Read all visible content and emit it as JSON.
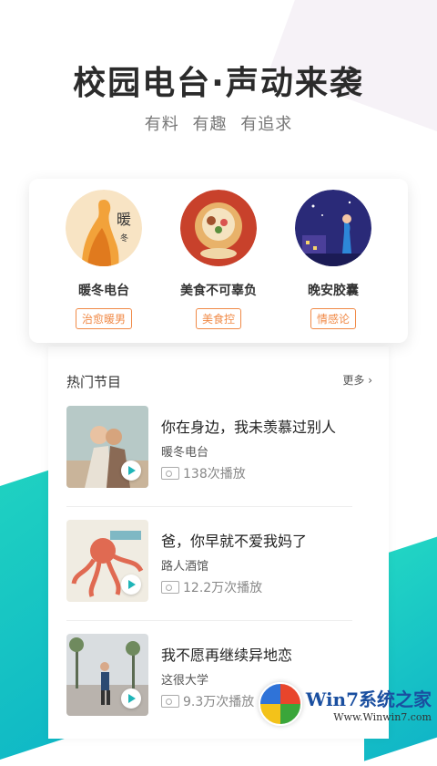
{
  "header": {
    "title": "校园电台·声动来袭",
    "tagline_items": [
      "有料",
      "有趣",
      "有追求"
    ]
  },
  "categories": [
    {
      "name": "暖冬电台",
      "tag": "治愈暖男",
      "thumb_icon": "warm-winter-cover"
    },
    {
      "name": "美食不可辜负",
      "tag": "美食控",
      "thumb_icon": "food-cover"
    },
    {
      "name": "晚安胶囊",
      "tag": "情感论",
      "thumb_icon": "night-cover"
    }
  ],
  "hot": {
    "title": "热门节目",
    "more_label": "更多",
    "programs": [
      {
        "title": "你在身边，我未羡慕过别人",
        "author": "暖冬电台",
        "plays": "138次播放"
      },
      {
        "title": "爸，你早就不爱我妈了",
        "author": "路人酒馆",
        "plays": "12.2万次播放"
      },
      {
        "title": "我不愿再继续异地恋",
        "author": "这很大学",
        "plays": "9.3万次播放"
      }
    ]
  },
  "watermark": {
    "brand": "Win7系统之家",
    "url": "Www.Winwin7.com"
  },
  "colors": {
    "accent_orange": "#f08a47",
    "teal": "#1fd1c1"
  }
}
